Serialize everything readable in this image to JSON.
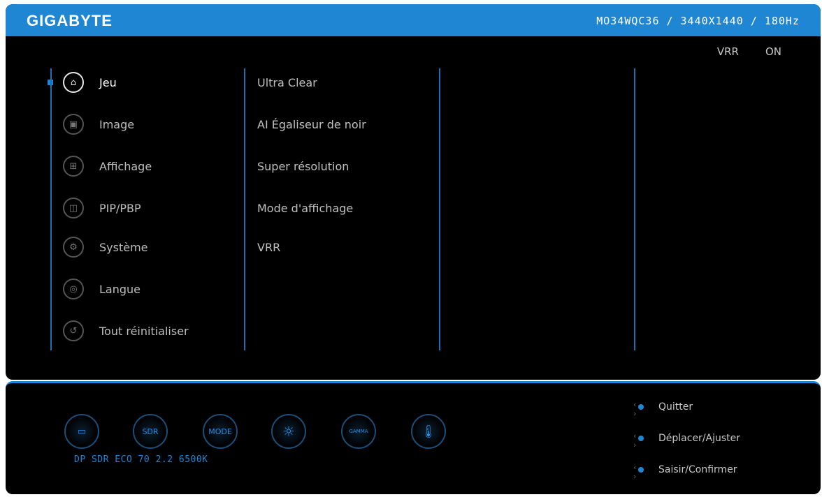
{
  "header": {
    "brand": "GIGABYTE",
    "model": "MO34WQC36",
    "resolution": "3440X1440",
    "refresh": "180Hz",
    "separator": "/"
  },
  "vrr": {
    "label": "VRR",
    "value": "ON"
  },
  "menu": [
    {
      "label": "Jeu",
      "icon": "gamepad-icon",
      "glyph": "⌂",
      "active": true
    },
    {
      "label": "Image",
      "icon": "image-icon",
      "glyph": "▣"
    },
    {
      "label": "Affichage",
      "icon": "display-grid-icon",
      "glyph": "⊞"
    },
    {
      "label": "PIP/PBP",
      "icon": "pip-icon",
      "glyph": "◫"
    },
    {
      "label": "Système",
      "icon": "gear-icon",
      "glyph": "⚙"
    },
    {
      "label": "Langue",
      "icon": "globe-icon",
      "glyph": "◎"
    },
    {
      "label": "Tout réinitialiser",
      "icon": "reset-icon",
      "glyph": "↺"
    }
  ],
  "submenu": [
    "Ultra Clear",
    "AI Égaliseur de noir",
    "Super résolution",
    "Mode d'affichage",
    "VRR"
  ],
  "status_bar": {
    "icons": [
      {
        "name": "input-port-icon",
        "text": "▭"
      },
      {
        "name": "sdr-icon",
        "text": "SDR"
      },
      {
        "name": "mode-icon",
        "text": "MODE"
      },
      {
        "name": "brightness-icon",
        "text": "☼"
      },
      {
        "name": "gamma-icon",
        "text": "GAMMA"
      },
      {
        "name": "temperature-icon",
        "text": "🌡"
      }
    ],
    "text": "DP SDR ECO 70 2.2 6500K"
  },
  "hints": [
    {
      "label": "Quitter"
    },
    {
      "label": "Déplacer/Ajuster"
    },
    {
      "label": "Saisir/Confirmer"
    }
  ]
}
